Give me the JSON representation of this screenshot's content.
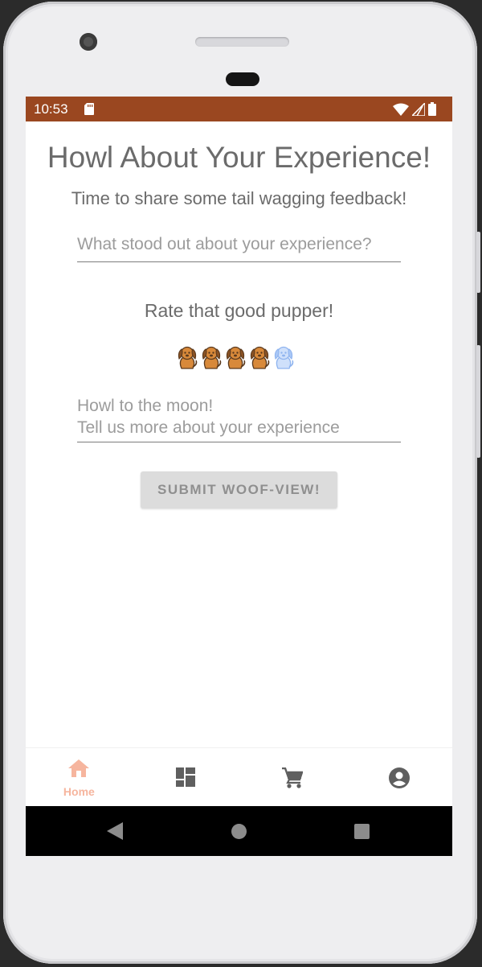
{
  "status_bar": {
    "time": "10:53",
    "background_color": "#9a4720",
    "icons": [
      "sd-card-icon",
      "wifi-icon",
      "signal-icon",
      "battery-icon"
    ]
  },
  "page": {
    "title": "Howl About Your Experience!",
    "subtitle": "Time to share some tail wagging feedback!"
  },
  "form": {
    "headline_placeholder": "What stood out about your experience?",
    "rating_label": "Rate that good pupper!",
    "rating": {
      "value": 4,
      "max": 5
    },
    "details_placeholder": "Howl to the moon!\nTell us more about your experience",
    "submit_label": "SUBMIT WOOF-VIEW!"
  },
  "bottom_nav": {
    "items": [
      {
        "label": "Home",
        "icon": "home-icon",
        "active": true
      },
      {
        "label": "",
        "icon": "dashboard-icon",
        "active": false
      },
      {
        "label": "",
        "icon": "cart-icon",
        "active": false
      },
      {
        "label": "",
        "icon": "account-icon",
        "active": false
      }
    ],
    "active_color": "#f6b59e",
    "inactive_color": "#5f5f5f"
  },
  "system_nav": {
    "buttons": [
      "back-icon",
      "home-circle-icon",
      "recents-icon"
    ]
  }
}
